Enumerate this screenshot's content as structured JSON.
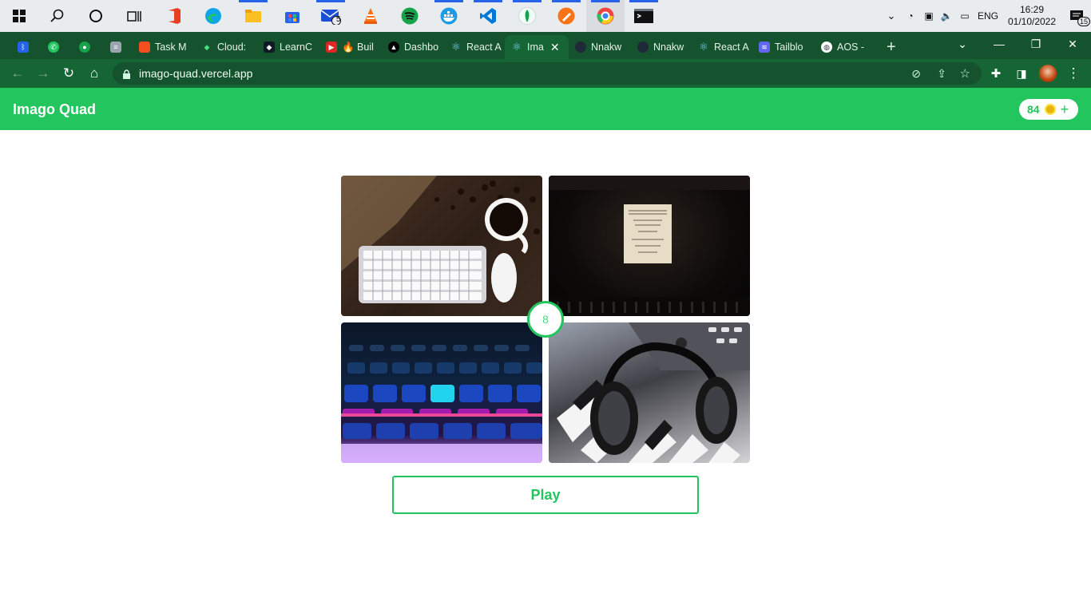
{
  "taskbar": {
    "mail_badge": "5",
    "tray": {
      "language": "ENG",
      "time": "16:29",
      "date": "01/10/2022",
      "notifications": "15"
    },
    "icons": [
      "windows-start-icon",
      "search-icon",
      "cortana-icon",
      "task-view-icon",
      "office-icon",
      "edge-icon",
      "file-explorer-icon",
      "store-icon",
      "mail-icon",
      "vlc-icon",
      "spotify-icon",
      "docker-icon",
      "vscode-icon",
      "mongodb-icon",
      "postman-icon",
      "chrome-icon",
      "terminal-icon"
    ]
  },
  "browser": {
    "tabs": [
      {
        "label": "",
        "icon": "bluetooth-icon",
        "color": "#2563eb"
      },
      {
        "label": "",
        "icon": "whatsapp-icon",
        "color": "#22c55e"
      },
      {
        "label": "",
        "icon": "extension-green-icon",
        "color": "#16a34a"
      },
      {
        "label": "",
        "icon": "list-icon",
        "color": "#9ca3af"
      },
      {
        "label": "Task M",
        "icon": "figma-icon",
        "color": "#f24e1e"
      },
      {
        "label": "Cloud:",
        "icon": "mongodb-icon",
        "color": "#16a34a"
      },
      {
        "label": "LearnC",
        "icon": "learn-icon",
        "color": "#111827"
      },
      {
        "label": "🔥 Buil",
        "icon": "youtube-icon",
        "color": "#dc2626"
      },
      {
        "label": "Dashbo",
        "icon": "vercel-icon",
        "color": "#000000"
      },
      {
        "label": "React A",
        "icon": "react-icon",
        "color": "#0ea5e9"
      },
      {
        "label": "Ima",
        "icon": "react-icon",
        "color": "#0ea5e9",
        "active": true
      },
      {
        "label": "Nnakw",
        "icon": "github-icon",
        "color": "#1f2937"
      },
      {
        "label": "Nnakw",
        "icon": "github-icon",
        "color": "#1f2937"
      },
      {
        "label": "React A",
        "icon": "react-icon",
        "color": "#0ea5e9"
      },
      {
        "label": "Tailblo",
        "icon": "tailblocks-icon",
        "color": "#6366f1"
      },
      {
        "label": "AOS - ",
        "icon": "globe-icon",
        "color": "#6b7280"
      }
    ],
    "new_tab_label": "+",
    "url": "imago-quad.vercel.app"
  },
  "app": {
    "title": "Imago Quad",
    "coins": "84",
    "add_label": "+",
    "counter": "8",
    "play_label": "Play",
    "tiles": [
      {
        "name": "coffee-keyboard-image"
      },
      {
        "name": "piano-sheet-music-image"
      },
      {
        "name": "rgb-keyboard-image"
      },
      {
        "name": "headphones-piano-image"
      }
    ]
  }
}
